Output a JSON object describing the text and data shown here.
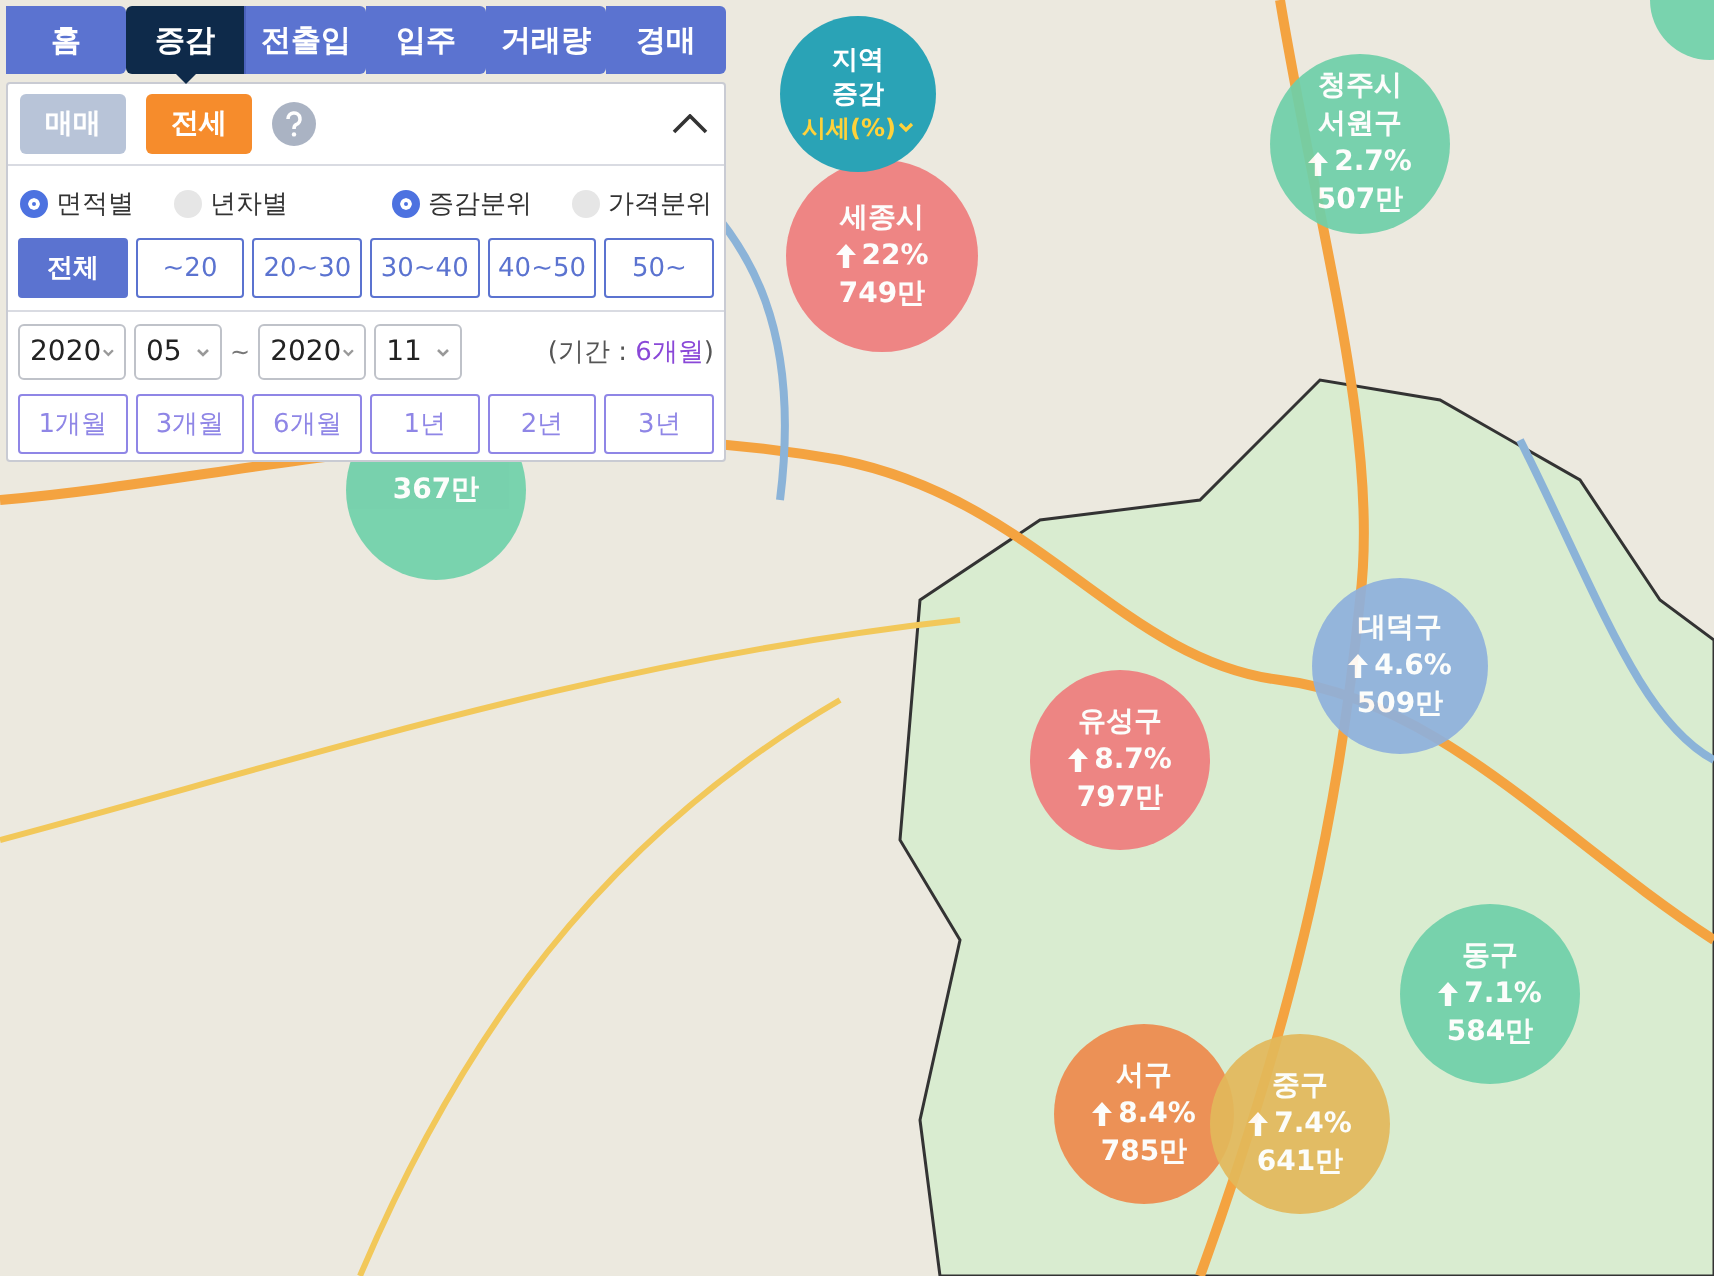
{
  "nav_tabs": [
    {
      "label": "홈",
      "selected": false
    },
    {
      "label": "증감",
      "selected": true
    },
    {
      "label": "전출입",
      "selected": false
    },
    {
      "label": "입주",
      "selected": false
    },
    {
      "label": "거래량",
      "selected": false
    },
    {
      "label": "경매",
      "selected": false
    }
  ],
  "panel": {
    "expanded": true,
    "deal_types": [
      {
        "label": "매매",
        "selected": false
      },
      {
        "label": "전세",
        "selected": true
      }
    ],
    "radios": [
      {
        "label": "면적별",
        "selected": true
      },
      {
        "label": "년차별",
        "selected": false
      },
      {
        "label": "증감분위",
        "selected": true
      },
      {
        "label": "가격분위",
        "selected": false
      }
    ],
    "area_buttons": [
      {
        "label": "전체",
        "selected": true
      },
      {
        "label": "~20",
        "selected": false
      },
      {
        "label": "20~30",
        "selected": false
      },
      {
        "label": "30~40",
        "selected": false
      },
      {
        "label": "40~50",
        "selected": false
      },
      {
        "label": "50~",
        "selected": false
      }
    ],
    "date_range": {
      "from_year": "2020",
      "from_month": "05",
      "separator": "~",
      "to_year": "2020",
      "to_month": "11",
      "period_prefix": "(기간 :",
      "period_value": "6개월",
      "period_suffix": ")"
    },
    "period_buttons": [
      "1개월",
      "3개월",
      "6개월",
      "1년",
      "2년",
      "3년"
    ]
  },
  "legend": {
    "lines": [
      "지역",
      "증감"
    ],
    "metric": "시세(%)"
  },
  "bubbles": [
    {
      "name": [
        "세종시"
      ],
      "change": "22%",
      "amount": "749만",
      "color": "#ef7d7d"
    },
    {
      "name": [
        "청주시",
        "서원구"
      ],
      "change": "2.7%",
      "amount": "507만",
      "color": "#6fd0a9"
    },
    {
      "name": [
        "대덕구"
      ],
      "change": "4.6%",
      "amount": "509만",
      "color": "#8fb1dd"
    },
    {
      "name": [
        "유성구"
      ],
      "change": "8.7%",
      "amount": "797만",
      "color": "#ef7d7d"
    },
    {
      "name": [
        "동구"
      ],
      "change": "7.1%",
      "amount": "584만",
      "color": "#6fd0a9"
    },
    {
      "name": [
        "서구"
      ],
      "change": "8.4%",
      "amount": "785만",
      "color": "#ee8a4c"
    },
    {
      "name": [
        "중구"
      ],
      "change": "7.4%",
      "amount": "641만",
      "color": "#e3b95b"
    },
    {
      "amount": "367만",
      "color": "#6fd0a9"
    },
    {
      "color": "#6fd0a9"
    }
  ]
}
